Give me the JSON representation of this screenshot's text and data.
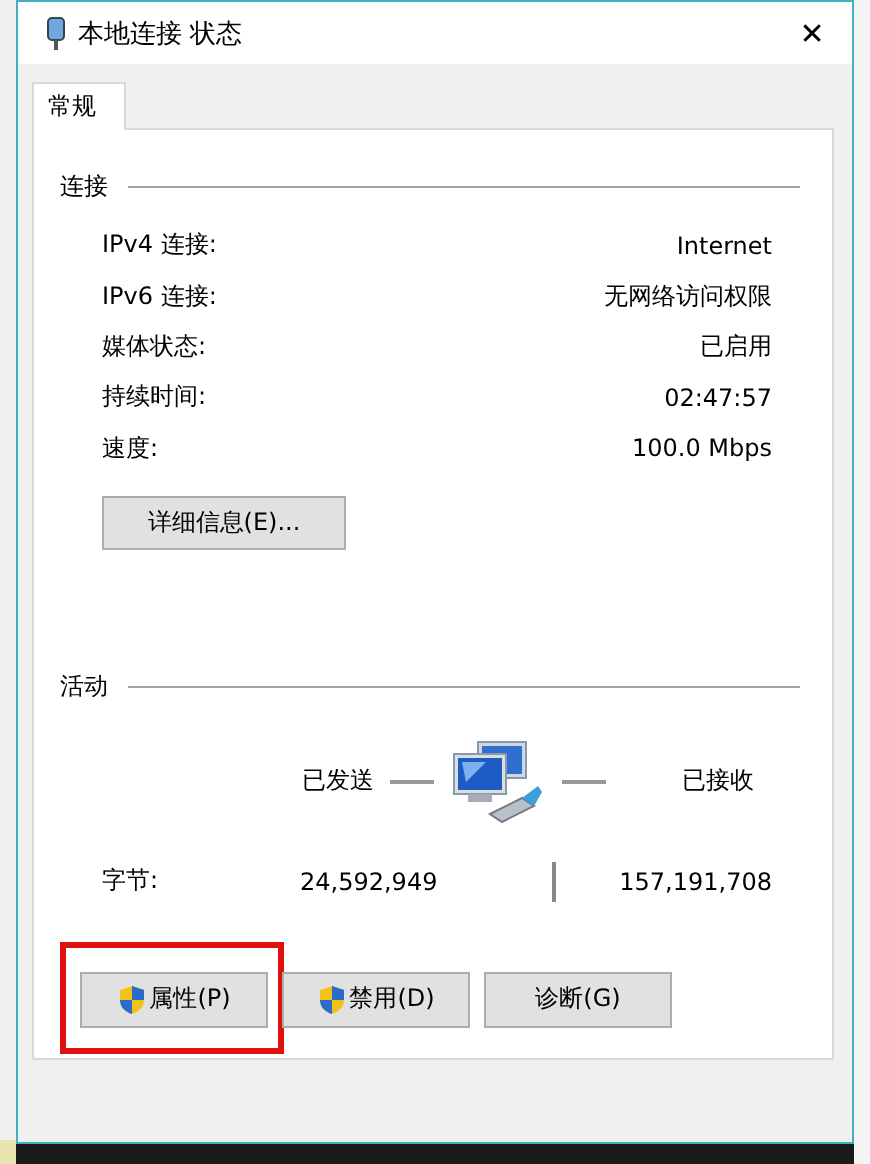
{
  "window": {
    "title": "本地连接 状态",
    "close": "✕"
  },
  "tabs": [
    {
      "label": "常规",
      "selected": true
    }
  ],
  "connection": {
    "heading": "连接",
    "rows": [
      {
        "label": "IPv4 连接:",
        "value": "Internet"
      },
      {
        "label": "IPv6 连接:",
        "value": "无网络访问权限"
      },
      {
        "label": "媒体状态:",
        "value": "已启用"
      },
      {
        "label": "持续时间:",
        "value": "02:47:57"
      },
      {
        "label": "速度:",
        "value": "100.0 Mbps"
      }
    ],
    "details_button": "详细信息(E)..."
  },
  "activity": {
    "heading": "活动",
    "sent_label": "已发送",
    "received_label": "已接收",
    "bytes_label": "字节:",
    "sent": "24,592,949",
    "received": "157,191,708"
  },
  "buttons": [
    {
      "label": "属性(P)",
      "shield": true,
      "highlighted": true
    },
    {
      "label": "禁用(D)",
      "shield": true,
      "highlighted": false
    },
    {
      "label": "诊断(G)",
      "shield": false,
      "highlighted": false
    }
  ]
}
